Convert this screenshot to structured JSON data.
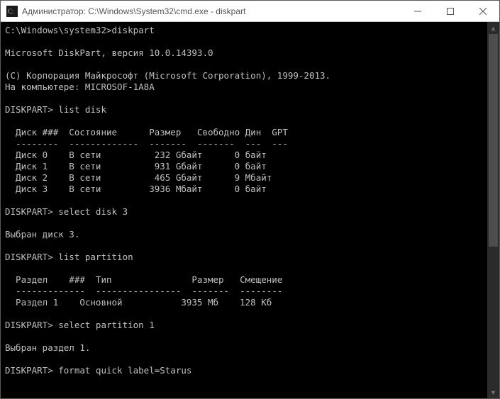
{
  "window": {
    "title": "Администратор: C:\\Windows\\System32\\cmd.exe - diskpart",
    "icon_name": "cmd-icon"
  },
  "terminal": {
    "prompt_path": "C:\\Windows\\system32>",
    "diskpart_prompt": "DISKPART>",
    "lines": {
      "line1": "C:\\Windows\\system32>diskpart",
      "blank": "",
      "line2": "Microsoft DiskPart, версия 10.0.14393.0",
      "line3": "(C) Корпорация Майкрософт (Microsoft Corporation), 1999-2013.",
      "line4": "На компьютере: MICROSOF-1A8A",
      "line5": "DISKPART> list disk",
      "disk_header": "  Диск ###  Состояние      Размер   Свободно Дин  GPT",
      "disk_sep": "  --------  -------------  -------  -------  ---  ---",
      "disk0": "  Диск 0    В сети          232 Gбайт      0 байт",
      "disk1": "  Диск 1    В сети          931 Gбайт      0 байт",
      "disk2": "  Диск 2    В сети          465 Gбайт      9 Mбайт",
      "disk3": "  Диск 3    В сети         3936 Mбайт      0 байт",
      "line6": "DISKPART> select disk 3",
      "line7": "Выбран диск 3.",
      "line8": "DISKPART> list partition",
      "part_header": "  Раздел    ###  Тип               Размер   Смещение",
      "part_sep": "  -------------  ----------------  -------  --------",
      "part1": "  Раздел 1    Основной           3935 Mб    128 Кб",
      "line9": "DISKPART> select partition 1",
      "line10": "Выбран раздел 1.",
      "line11": "DISKPART> format quick label=Starus"
    }
  }
}
